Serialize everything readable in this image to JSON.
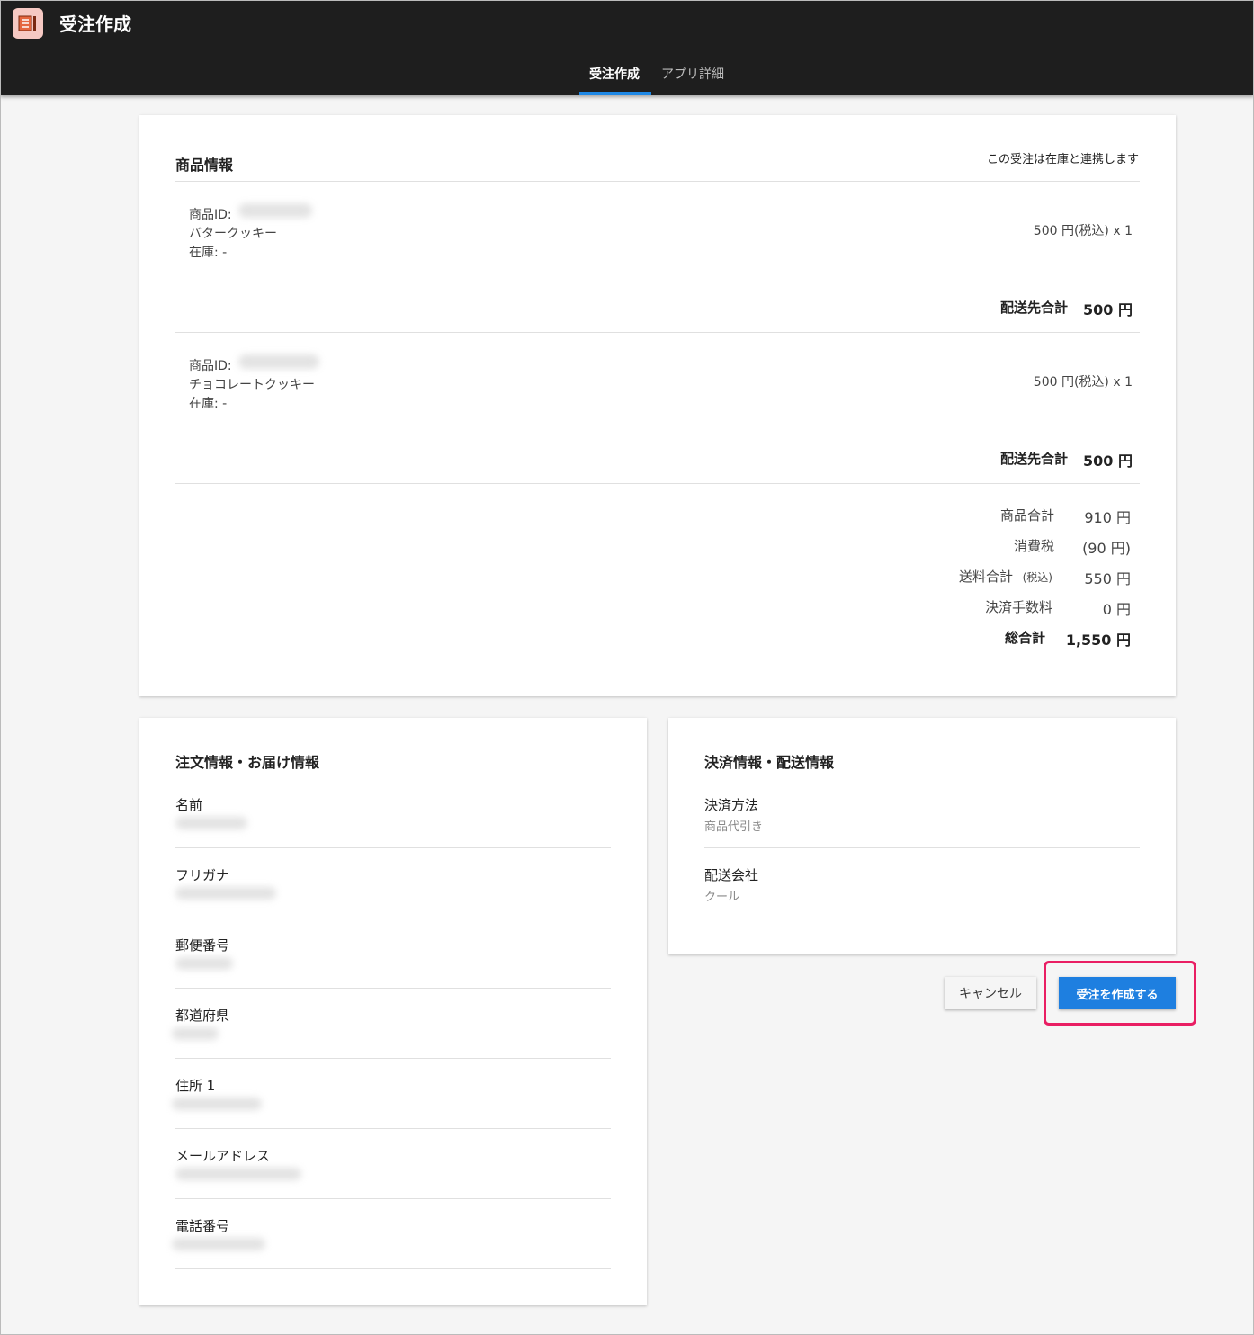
{
  "header": {
    "app_icon": "document-icon",
    "title": "受注作成",
    "tabs": [
      {
        "label": "受注作成",
        "active": true
      },
      {
        "label": "アプリ詳細",
        "active": false
      }
    ],
    "accent": "#1e88e5"
  },
  "product_card": {
    "title": "商品情報",
    "note": "この受注は在庫と連携します",
    "items": [
      {
        "id_label": "商品ID:",
        "name": "バタークッキー",
        "stock": "在庫: -",
        "price": "500 円(税込) x 1",
        "subtotal_label": "配送先合計",
        "subtotal_value": "500 円"
      },
      {
        "id_label": "商品ID:",
        "name": "チョコレートクッキー",
        "stock": "在庫: -",
        "price": "500 円(税込) x 1",
        "subtotal_label": "配送先合計",
        "subtotal_value": "500 円"
      }
    ],
    "totals": [
      {
        "label": "商品合計",
        "value": "910 円"
      },
      {
        "label": "消費税",
        "value": "(90 円)"
      },
      {
        "label": "送料合計",
        "label_small": "(税込)",
        "value": "550 円"
      },
      {
        "label": "決済手数料",
        "value": "0 円"
      },
      {
        "label": "総合計",
        "value": "1,550 円",
        "bold": true
      }
    ]
  },
  "order_card": {
    "title": "注文情報・お届け情報",
    "fields": [
      {
        "label": "名前"
      },
      {
        "label": "フリガナ"
      },
      {
        "label": "郵便番号"
      },
      {
        "label": "都道府県"
      },
      {
        "label": "住所 1"
      },
      {
        "label": "メールアドレス"
      },
      {
        "label": "電話番号"
      }
    ]
  },
  "payment_card": {
    "title": "決済情報・配送情報",
    "fields": [
      {
        "label": "決済方法",
        "value": "商品代引き"
      },
      {
        "label": "配送会社",
        "value": "クール"
      }
    ]
  },
  "actions": {
    "cancel_label": "キャンセル",
    "create_label": "受注を作成する",
    "primary_color": "#1e7fe0",
    "highlight_color": "#e91e63"
  }
}
